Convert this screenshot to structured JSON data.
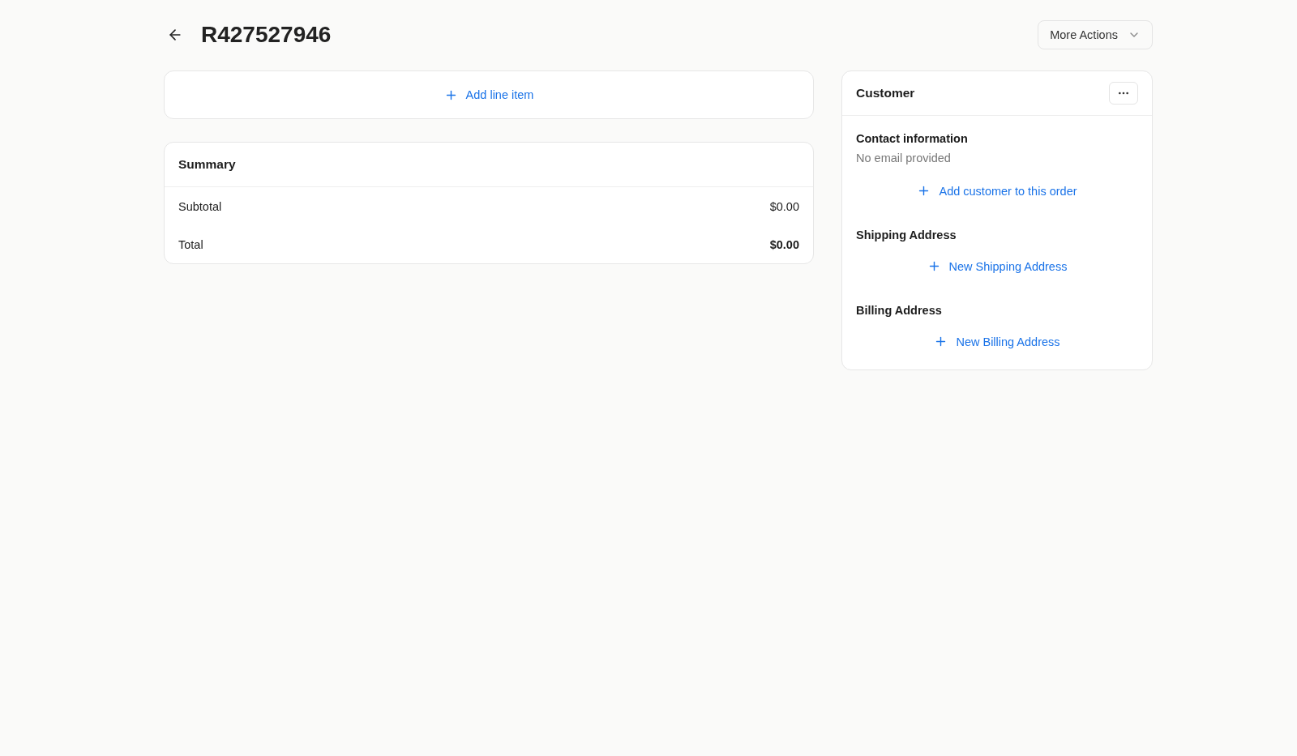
{
  "header": {
    "title": "R427527946",
    "more_actions": "More Actions"
  },
  "line_items": {
    "add_label": "Add line item"
  },
  "summary": {
    "title": "Summary",
    "rows": [
      {
        "kind": "normal",
        "label": "Subtotal",
        "value": "$0.00"
      },
      {
        "kind": "total",
        "label": "Total",
        "value": "$0.00"
      }
    ]
  },
  "customer": {
    "title": "Customer",
    "sections": [
      {
        "heading": "Contact information",
        "note": "No email provided",
        "action": "Add customer to this order"
      },
      {
        "heading": "Shipping Address",
        "action": "New Shipping Address"
      },
      {
        "heading": "Billing Address",
        "action": "New Billing Address"
      }
    ]
  }
}
